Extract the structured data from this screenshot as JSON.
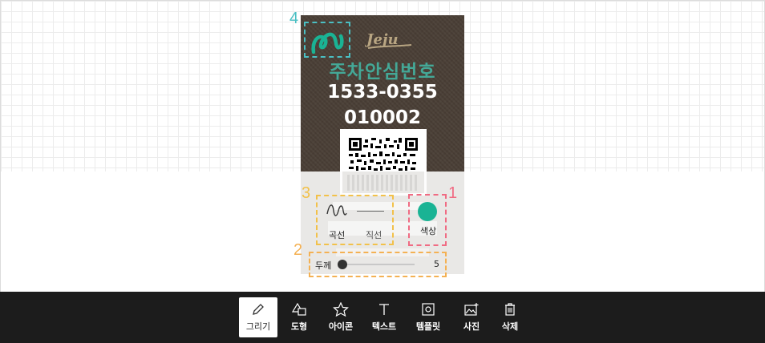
{
  "card": {
    "brand": "Jeju",
    "title": "주차안심번호",
    "phone": "1533-0355",
    "code": "010002"
  },
  "annotations": {
    "n1": "1",
    "n2": "2",
    "n3": "3",
    "n4": "4"
  },
  "draw_panel": {
    "curve_label": "곡선",
    "straight_label": "직선",
    "color_label": "색상",
    "thickness_label": "두께",
    "thickness_value": "5",
    "selected_color": "#1ab394"
  },
  "toolbar": {
    "draw": "그리기",
    "shape": "도형",
    "icon": "아이콘",
    "text": "텍스트",
    "template": "템플릿",
    "photo": "사진",
    "delete": "삭제"
  },
  "colors": {
    "anno1": "#f06b83",
    "anno2": "#f4b153",
    "anno3": "#f2c14a",
    "anno4": "#4bbfc3",
    "accent_teal": "#1ab394"
  }
}
